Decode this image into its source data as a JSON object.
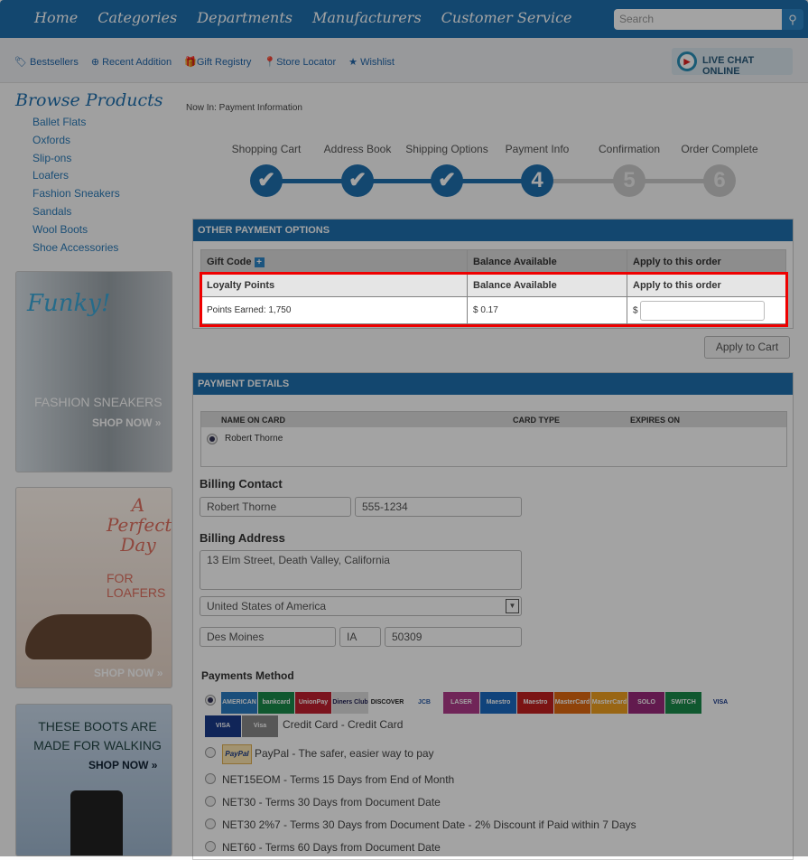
{
  "nav": {
    "items": [
      "Home",
      "Categories",
      "Departments",
      "Manufacturers",
      "Customer Service"
    ],
    "search_placeholder": "Search"
  },
  "sublinks": [
    "Bestsellers",
    "Recent Addition",
    "Gift Registry",
    "Store Locator",
    "Wishlist"
  ],
  "live_chat": "LIVE CHAT ONLINE",
  "sidebar": {
    "title": "Browse Products",
    "categories": [
      "Ballet Flats",
      "Oxfords",
      "Slip-ons",
      "Loafers",
      "Fashion Sneakers",
      "Sandals",
      "Wool Boots",
      "Shoe Accessories"
    ],
    "ads": [
      {
        "headline": "Funky!",
        "sub": "FASHION SNEAKERS",
        "cta": "SHOP NOW »"
      },
      {
        "headline": "A Perfect Day",
        "sub": "FOR LOAFERS",
        "cta": "SHOP NOW »"
      },
      {
        "headline": "THESE BOOTS ARE MADE FOR WALKING",
        "cta": "SHOP NOW »"
      }
    ]
  },
  "breadcrumb": "Now In: Payment Information",
  "steps": [
    {
      "label": "Shopping Cart",
      "mark": "✔"
    },
    {
      "label": "Address Book",
      "mark": "✔"
    },
    {
      "label": "Shipping Options",
      "mark": "✔"
    },
    {
      "label": "Payment Info",
      "mark": "4"
    },
    {
      "label": "Confirmation",
      "mark": "5"
    },
    {
      "label": "Order Complete",
      "mark": "6"
    }
  ],
  "other_payment": {
    "title": "OTHER PAYMENT OPTIONS",
    "gift_code": "Gift Code",
    "balance": "Balance Available",
    "apply": "Apply to this order",
    "loyalty": "Loyalty Points",
    "points": "Points Earned: 1,750",
    "balance_value": "$ 0.17",
    "currency": "$",
    "apply_value": "",
    "apply_button": "Apply to Cart"
  },
  "payment_details": {
    "title": "PAYMENT DETAILS",
    "cols": [
      "NAME ON CARD",
      "CARD TYPE",
      "EXPIRES ON"
    ],
    "card_name": "Robert Thorne",
    "billing_contact": "Billing Contact",
    "name": "Robert Thorne",
    "phone": "555-1234",
    "billing_address": "Billing Address",
    "address": "13 Elm Street, Death Valley, California",
    "country": "United States of America",
    "city": "Des Moines",
    "state": "IA",
    "zip": "50309",
    "payments_method": "Payments Method",
    "cards": [
      "AMERICAN EXPRESS",
      "bankcard",
      "UnionPay",
      "Diners Club",
      "DISCOVER",
      "JCB",
      "LASER",
      "Maestro",
      "Maestro",
      "MasterCard",
      "MasterCard",
      "SOLO",
      "SWITCH",
      "VISA",
      "VISA Electron",
      "Visa Purchasing"
    ],
    "methods": [
      "Credit Card - Credit Card",
      "PayPal - The safer, easier way to pay",
      "NET15EOM - Terms 15 Days from End of Month",
      "NET30 - Terms 30 Days from Document Date",
      "NET30 2%7 - Terms 30 Days from Document Date - 2% Discount if Paid within 7 Days",
      "NET60 - Terms 60 Days from Document Date"
    ],
    "paypal": "PayPal"
  }
}
